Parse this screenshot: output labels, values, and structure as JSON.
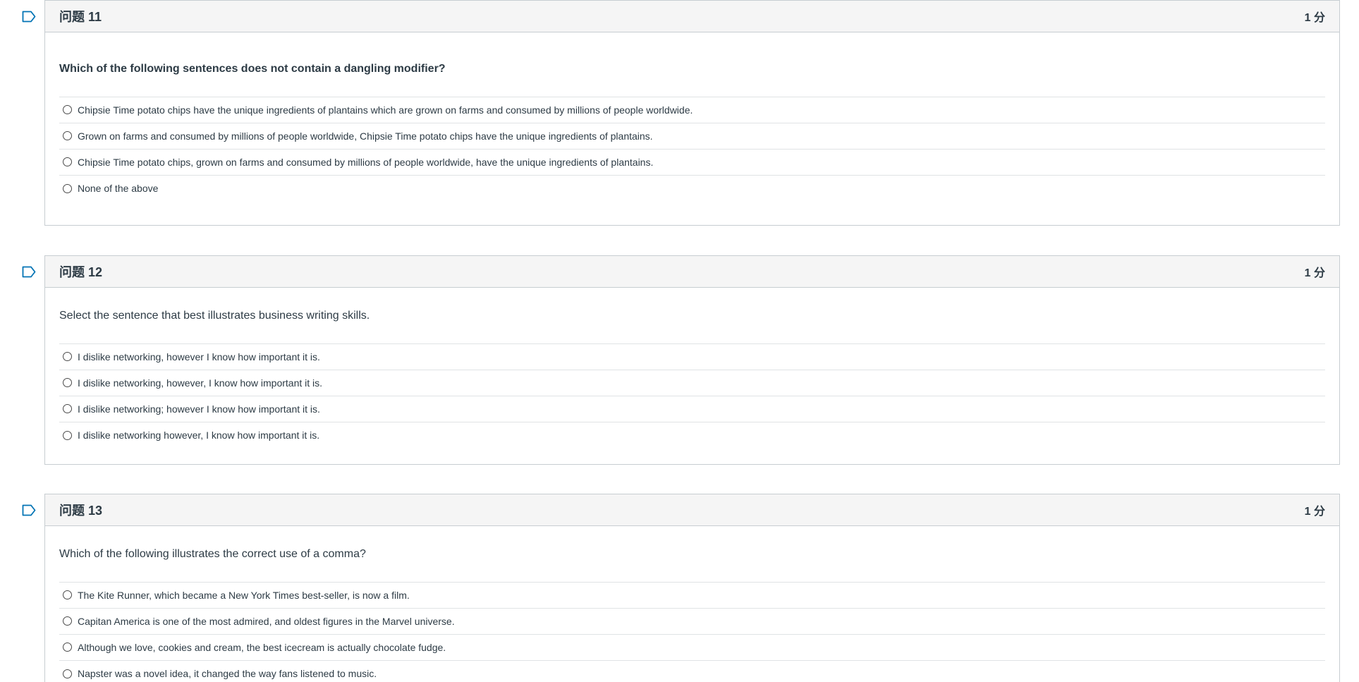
{
  "questions": [
    {
      "title": "问题 11",
      "points": "1 分",
      "text": "Which of the following sentences does not contain a dangling modifier?",
      "answers": [
        "Chipsie Time potato chips have the unique ingredients of plantains which are grown on farms and consumed by millions of people worldwide.",
        "Grown on farms and consumed by millions of people worldwide, Chipsie Time potato chips have the unique ingredients of plantains.",
        "Chipsie Time potato chips, grown on farms and consumed by millions of people worldwide, have the unique ingredients of plantains.",
        "None of the above"
      ]
    },
    {
      "title": "问题 12",
      "points": "1 分",
      "text": "Select the sentence that best illustrates business writing skills.",
      "answers": [
        "I dislike networking, however I know how important it is.",
        "I dislike networking, however, I know how important it is.",
        "I dislike networking; however I know how important it is.",
        "I dislike networking however, I know how important it is."
      ]
    },
    {
      "title": "问题 13",
      "points": "1 分",
      "text": "Which of the following illustrates the correct use of a comma?",
      "answers": [
        "The Kite Runner, which became a New York Times best-seller, is now a film.",
        "Capitan America is one of the most admired, and oldest figures in the Marvel universe.",
        "Although we love, cookies and cream, the best icecream is actually chocolate fudge.",
        "Napster was a novel idea, it changed the way fans listened to music."
      ]
    }
  ],
  "colors": {
    "header_bg": "#f5f5f5",
    "border": "#c7cdd1",
    "text": "#2d3b45",
    "flag": "#0374b5"
  },
  "icons": {
    "flag": "flag-icon",
    "radio": "radio-button"
  }
}
